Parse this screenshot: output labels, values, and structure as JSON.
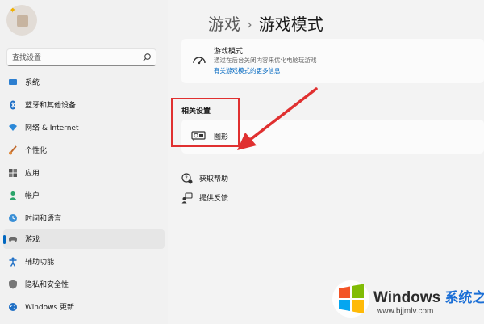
{
  "sidebar": {
    "search_placeholder": "查找设置",
    "items": [
      {
        "label": "系统"
      },
      {
        "label": "蓝牙和其他设备"
      },
      {
        "label": "网络 & Internet"
      },
      {
        "label": "个性化"
      },
      {
        "label": "应用"
      },
      {
        "label": "帐户"
      },
      {
        "label": "时间和语言"
      },
      {
        "label": "游戏",
        "selected": true
      },
      {
        "label": "辅助功能"
      },
      {
        "label": "隐私和安全性"
      },
      {
        "label": "Windows 更新"
      }
    ]
  },
  "header": {
    "parent": "游戏",
    "separator": "›",
    "title": "游戏模式"
  },
  "game_mode_card": {
    "title": "游戏模式",
    "description": "通过在后台关闭内容来优化电脑玩游戏",
    "link": "有关游戏模式的更多信息"
  },
  "related": {
    "title": "相关设置",
    "items": [
      {
        "label": "图形"
      }
    ]
  },
  "help": {
    "items": [
      {
        "label": "获取帮助"
      },
      {
        "label": "提供反馈"
      }
    ]
  },
  "watermark": {
    "brand": "Windows",
    "brand_cn": "系统之家",
    "url": "www.bjjmlv.com"
  },
  "colors": {
    "accent": "#0067c0",
    "highlight_red": "#e03030"
  }
}
